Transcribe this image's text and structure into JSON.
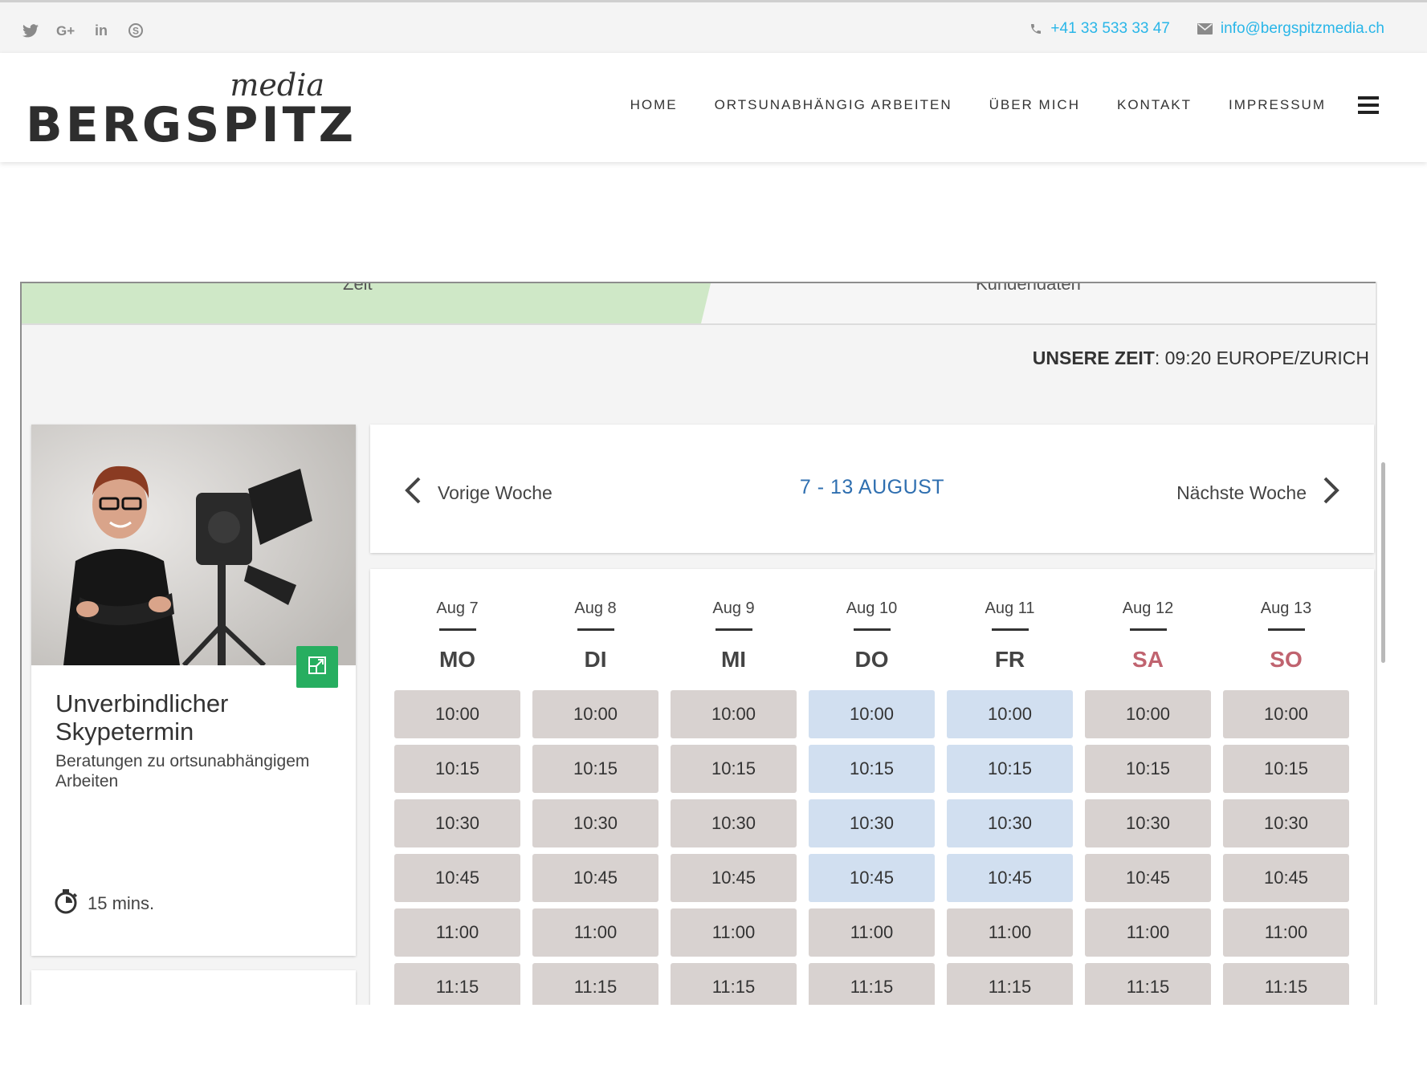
{
  "topbar": {
    "social_icons": [
      "twitter-icon",
      "google-plus-icon",
      "linkedin-icon",
      "skype-icon"
    ],
    "phone": "+41 33 533 33 47",
    "email": "info@bergspitzmedia.ch"
  },
  "header": {
    "logo_top": "media",
    "logo_brand": "BERGSPITZ",
    "nav": [
      "HOME",
      "ORTSUNABHÄNGIG ARBEITEN",
      "ÜBER MICH",
      "KONTAKT",
      "IMPRESSUM"
    ]
  },
  "booking": {
    "steps": [
      "Zeit",
      "Kundendaten"
    ],
    "our_time_label": "UNSERE ZEIT",
    "our_time_value": ": 09:20 EUROPE/ZURICH",
    "service": {
      "title": "Unverbindlicher Skypetermin",
      "subtitle": "Beratungen zu ortsunabhängigem Arbeiten",
      "duration": "15 mins."
    },
    "week": {
      "prev_label": "Vorige Woche",
      "range": "7 - 13 AUGUST",
      "next_label": "Nächste Woche"
    },
    "days": [
      {
        "date": "Aug 7",
        "dow": "MO",
        "weekend": false,
        "slots": [
          {
            "time": "10:00",
            "available": false
          },
          {
            "time": "10:15",
            "available": false
          },
          {
            "time": "10:30",
            "available": false
          },
          {
            "time": "10:45",
            "available": false
          },
          {
            "time": "11:00",
            "available": false
          },
          {
            "time": "11:15",
            "available": false
          }
        ]
      },
      {
        "date": "Aug 8",
        "dow": "DI",
        "weekend": false,
        "slots": [
          {
            "time": "10:00",
            "available": false
          },
          {
            "time": "10:15",
            "available": false
          },
          {
            "time": "10:30",
            "available": false
          },
          {
            "time": "10:45",
            "available": false
          },
          {
            "time": "11:00",
            "available": false
          },
          {
            "time": "11:15",
            "available": false
          }
        ]
      },
      {
        "date": "Aug 9",
        "dow": "MI",
        "weekend": false,
        "slots": [
          {
            "time": "10:00",
            "available": false
          },
          {
            "time": "10:15",
            "available": false
          },
          {
            "time": "10:30",
            "available": false
          },
          {
            "time": "10:45",
            "available": false
          },
          {
            "time": "11:00",
            "available": false
          },
          {
            "time": "11:15",
            "available": false
          }
        ]
      },
      {
        "date": "Aug 10",
        "dow": "DO",
        "weekend": false,
        "slots": [
          {
            "time": "10:00",
            "available": true
          },
          {
            "time": "10:15",
            "available": true
          },
          {
            "time": "10:30",
            "available": true
          },
          {
            "time": "10:45",
            "available": true
          },
          {
            "time": "11:00",
            "available": false
          },
          {
            "time": "11:15",
            "available": false
          }
        ]
      },
      {
        "date": "Aug 11",
        "dow": "FR",
        "weekend": false,
        "slots": [
          {
            "time": "10:00",
            "available": true
          },
          {
            "time": "10:15",
            "available": true
          },
          {
            "time": "10:30",
            "available": true
          },
          {
            "time": "10:45",
            "available": true
          },
          {
            "time": "11:00",
            "available": false
          },
          {
            "time": "11:15",
            "available": false
          }
        ]
      },
      {
        "date": "Aug 12",
        "dow": "SA",
        "weekend": true,
        "slots": [
          {
            "time": "10:00",
            "available": false
          },
          {
            "time": "10:15",
            "available": false
          },
          {
            "time": "10:30",
            "available": false
          },
          {
            "time": "10:45",
            "available": false
          },
          {
            "time": "11:00",
            "available": false
          },
          {
            "time": "11:15",
            "available": false
          }
        ]
      },
      {
        "date": "Aug 13",
        "dow": "SO",
        "weekend": true,
        "slots": [
          {
            "time": "10:00",
            "available": false
          },
          {
            "time": "10:15",
            "available": false
          },
          {
            "time": "10:30",
            "available": false
          },
          {
            "time": "10:45",
            "available": false
          },
          {
            "time": "11:00",
            "available": false
          },
          {
            "time": "11:15",
            "available": false
          }
        ]
      }
    ]
  },
  "colors": {
    "accent_blue": "#2f6fb0",
    "link_cyan": "#29b6e8",
    "step_done_green": "#cfe8c7",
    "expand_green": "#27ae60",
    "slot_booked": "#d8d2d0",
    "slot_available": "#d1dff0",
    "weekend_red": "#c0636f"
  }
}
